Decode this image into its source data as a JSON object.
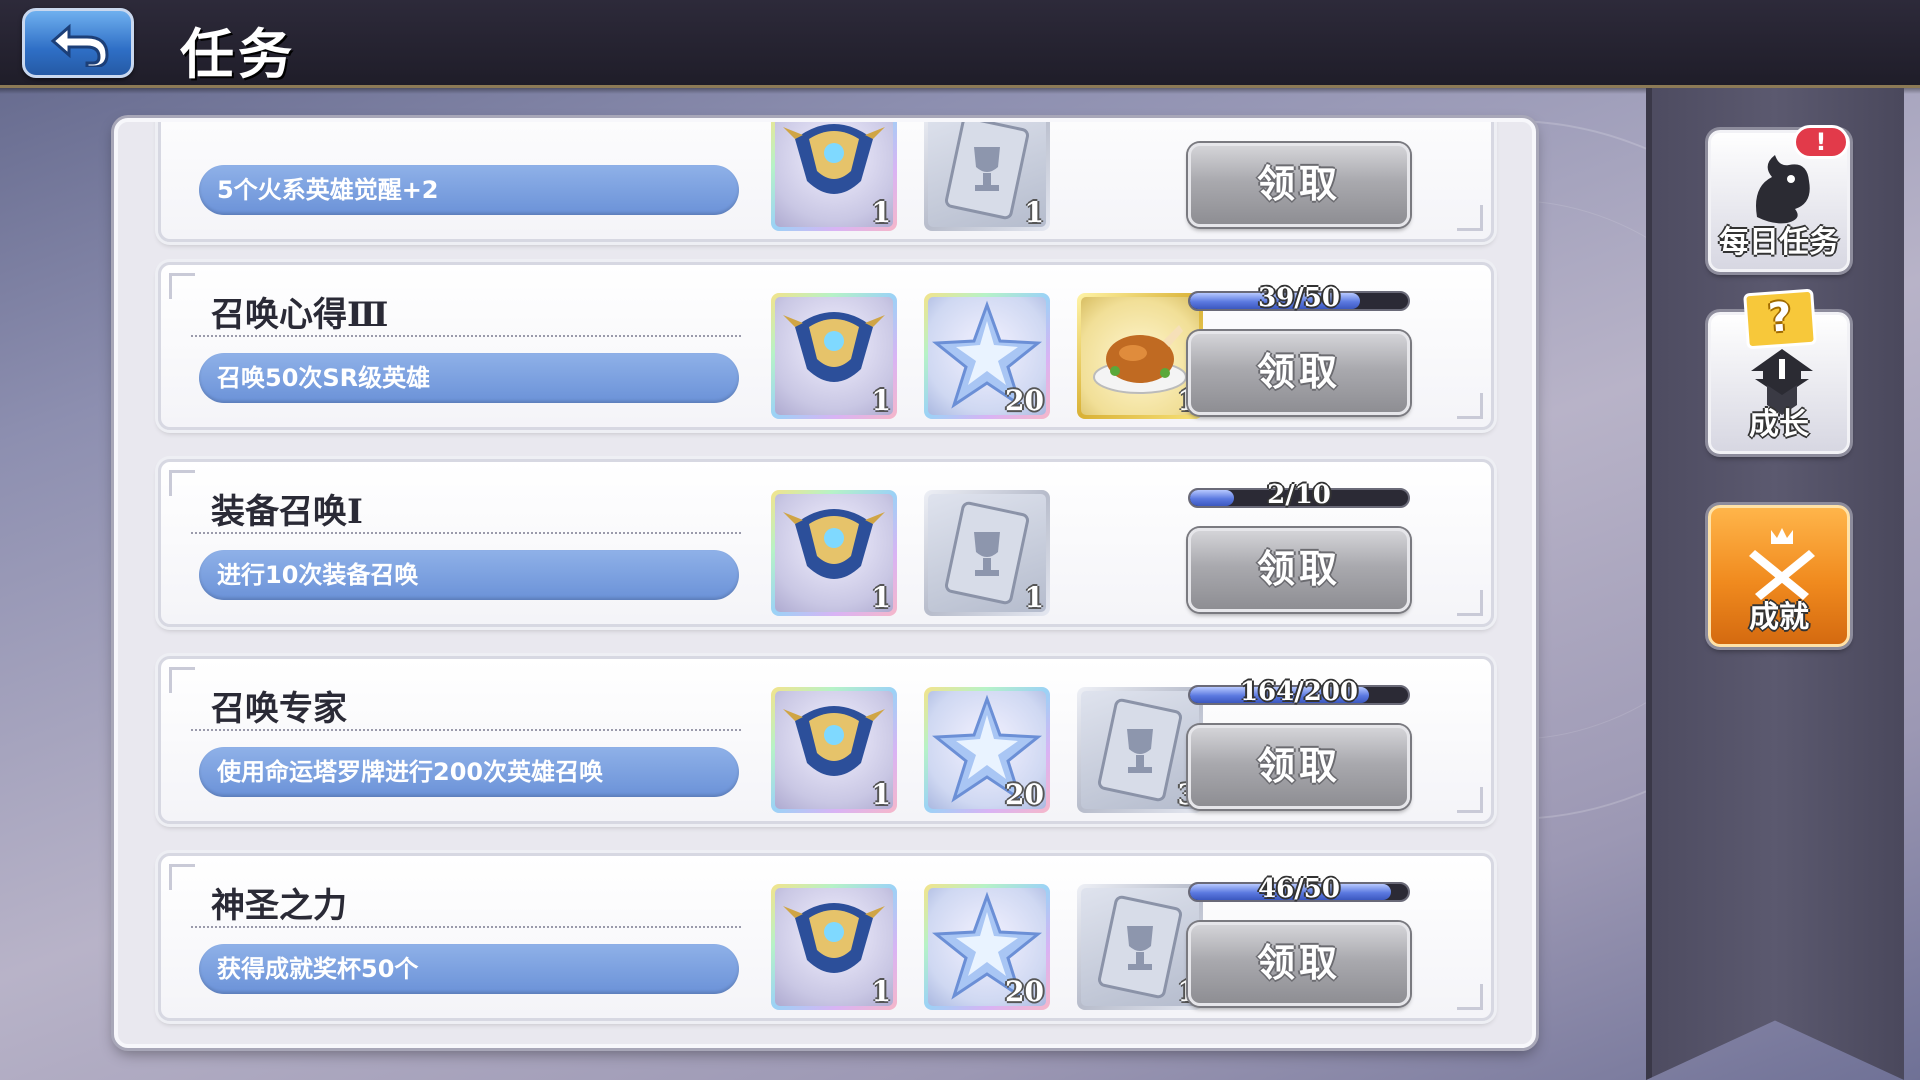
{
  "header": {
    "title": "任务"
  },
  "side_nav": {
    "items": [
      {
        "label": "每日任务",
        "badge": "!",
        "icon": "dragon-icon"
      },
      {
        "label": "成长",
        "badge": "?",
        "icon": "growth-icon"
      },
      {
        "label": "成就",
        "icon": "achievement-icon",
        "active": true
      }
    ]
  },
  "tasks": [
    {
      "title": "",
      "desc": "5个火系英雄觉醒+2",
      "rewards": [
        {
          "type": "helm",
          "qty": "1"
        },
        {
          "type": "card",
          "qty": "1"
        }
      ],
      "progress_text": "",
      "progress": null,
      "button": "领取"
    },
    {
      "title": "召唤心得Ⅲ",
      "desc": "召唤50次SR级英雄",
      "rewards": [
        {
          "type": "helm",
          "qty": "1"
        },
        {
          "type": "star",
          "qty": "20"
        },
        {
          "type": "food",
          "qty": "1"
        }
      ],
      "progress_text": "39/50",
      "progress": 0.78,
      "button": "领取"
    },
    {
      "title": "装备召唤Ⅰ",
      "desc": "进行10次装备召唤",
      "rewards": [
        {
          "type": "helm",
          "qty": "1"
        },
        {
          "type": "card",
          "qty": "1"
        }
      ],
      "progress_text": "2/10",
      "progress": 0.2,
      "button": "领取"
    },
    {
      "title": "召唤专家",
      "desc": "使用命运塔罗牌进行200次英雄召唤",
      "rewards": [
        {
          "type": "helm",
          "qty": "1"
        },
        {
          "type": "star",
          "qty": "20"
        },
        {
          "type": "card",
          "qty": "3"
        }
      ],
      "progress_text": "164/200",
      "progress": 0.82,
      "button": "领取"
    },
    {
      "title": "神圣之力",
      "desc": "获得成就奖杯50个",
      "rewards": [
        {
          "type": "helm",
          "qty": "1"
        },
        {
          "type": "star",
          "qty": "20"
        },
        {
          "type": "card",
          "qty": "1"
        }
      ],
      "progress_text": "46/50",
      "progress": 0.92,
      "button": "领取"
    }
  ]
}
